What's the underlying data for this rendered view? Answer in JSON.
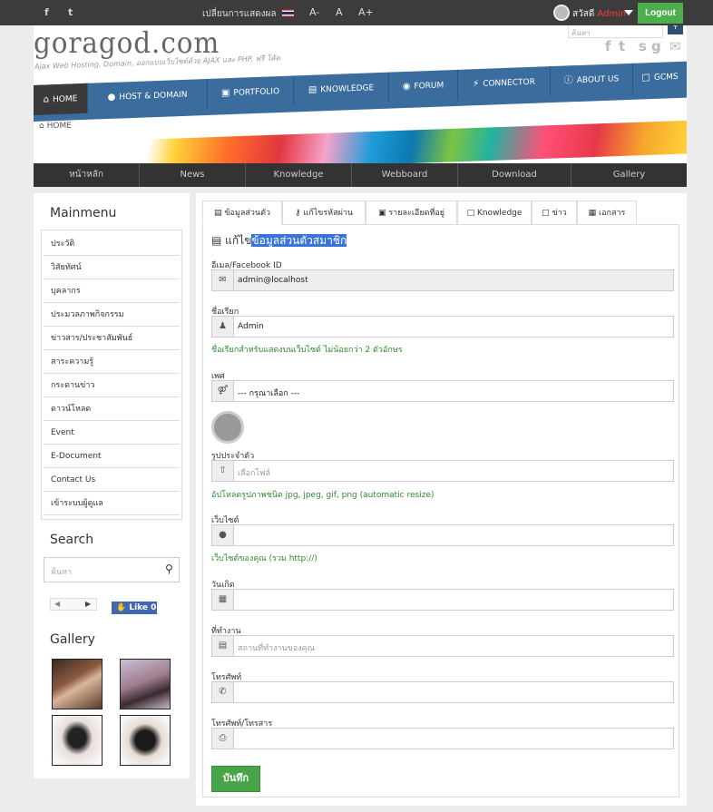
{
  "topbar": {
    "display_label": "เปลี่ยนการแสดงผล",
    "font_small": "A-",
    "font_normal": "A",
    "font_large": "A+",
    "greeting": "สวัสดี",
    "username": "Admin",
    "logout_label": "Logout"
  },
  "header": {
    "logo": "goragod.com",
    "tagline": "Ajax Web Hosting, Domain, ออกแบบเว็บไซต์ด้วย AJAX และ PHP, ฟรี โค้ด",
    "search_placeholder": "ค้นหา"
  },
  "nav": {
    "items": [
      {
        "label": "HOME"
      },
      {
        "label": "HOST & DOMAIN"
      },
      {
        "label": "PORTFOLIO"
      },
      {
        "label": "KNOWLEDGE"
      },
      {
        "label": "FORUM"
      },
      {
        "label": "CONNECTOR"
      },
      {
        "label": "ABOUT US"
      },
      {
        "label": "GCMS"
      }
    ],
    "breadcrumb": "HOME"
  },
  "subnav": {
    "items": [
      {
        "label": "หน้าหลัก"
      },
      {
        "label": "News"
      },
      {
        "label": "Knowledge"
      },
      {
        "label": "Webboard"
      },
      {
        "label": "Download"
      },
      {
        "label": "Gallery"
      }
    ]
  },
  "sidebar": {
    "menu_title": "Mainmenu",
    "menu": [
      {
        "label": "ประวัติ"
      },
      {
        "label": "วิสัยทัศน์"
      },
      {
        "label": "บุคลากร"
      },
      {
        "label": "ประมวลภาพกิจกรรม"
      },
      {
        "label": "ข่าวสาร/ประชาสัมพันธ์"
      },
      {
        "label": "สาระความรู้"
      },
      {
        "label": "กระดานข่าว"
      },
      {
        "label": "ดาวน์โหลด"
      },
      {
        "label": "Event"
      },
      {
        "label": "E-Document"
      },
      {
        "label": "Contact Us"
      },
      {
        "label": "เข้าระบบผู้ดูแล"
      }
    ],
    "search_title": "Search",
    "search_placeholder": "ค้นหา",
    "like_label": "Like 0",
    "gallery_title": "Gallery"
  },
  "content": {
    "tabs": [
      {
        "label": "ข้อมูลส่วนตัว"
      },
      {
        "label": "แก้ไขรหัสผ่าน"
      },
      {
        "label": "รายละเอียดที่อยู่"
      },
      {
        "label": "Knowledge"
      },
      {
        "label": "ข่าว"
      },
      {
        "label": "เอกสาร"
      }
    ],
    "form_title_prefix": "แก้ไข",
    "form_title_selected": "ข้อมูลส่วนตัวสมาชิก",
    "fields": {
      "email_label": "อีเมล/Facebook ID",
      "email_value": "admin@localhost",
      "name_label": "ชื่อเรียก",
      "name_value": "Admin",
      "name_help": "ชื่อเรียกสำหรับแสดงบนเว็บไซต์ ไม่น้อยกว่า 2 ตัวอักษร",
      "sex_label": "เพศ",
      "sex_value": "--- กรุณาเลือก ---",
      "avatar_label": "รูปประจำตัว",
      "avatar_placeholder": "เลือกไฟล์",
      "avatar_help": "อัปโหลดรูปภาพชนิด jpg, jpeg, gif, png (automatic resize)",
      "website_label": "เว็บไซต์",
      "website_help": "เว็บไซต์ของคุณ (รวม http://)",
      "birthday_label": "วันเกิด",
      "workplace_label": "ที่ทำงาน",
      "workplace_placeholder": "สถานที่ทำงานของคุณ",
      "phone_label": "โทรศัพท์",
      "fax_label": "โทรศัพท์/โทรสาร"
    },
    "save_label": "บันทึก"
  }
}
